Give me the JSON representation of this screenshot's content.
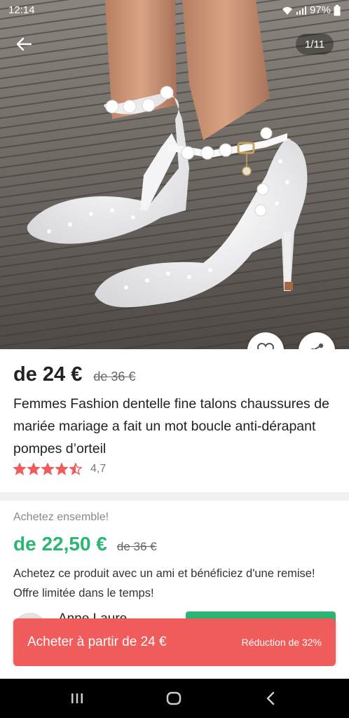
{
  "status": {
    "time": "12:14",
    "battery": "97%",
    "icons": [
      "wifi-icon",
      "signal-icon",
      "battery-icon"
    ]
  },
  "gallery": {
    "counter": "1/11",
    "image": "white-lace-pearl-heels"
  },
  "product": {
    "price": "de 24 €",
    "old_price": "de 36 €",
    "title": "Femmes Fashion dentelle fine talons chaussures de mariée mariage a fait un mot boucle anti-dérapant pompes d’orteil",
    "rating_value": "4,7",
    "rating_stars": 4.5
  },
  "group_buy": {
    "label": "Achetez ensemble!",
    "price": "de 22,50 €",
    "old_price": "de 36 €",
    "description": "Achetez ce produit avec un ami et bénéficiez d'une remise! Offre limitée dans le temps!",
    "partner_name": "Anne Laure"
  },
  "buy_bar": {
    "label": "Acheter à partir de 24 €",
    "discount": "Réduction de 32%"
  },
  "colors": {
    "accent_red": "#f05b5b",
    "accent_green": "#2bb673",
    "star": "#f05b5b"
  }
}
